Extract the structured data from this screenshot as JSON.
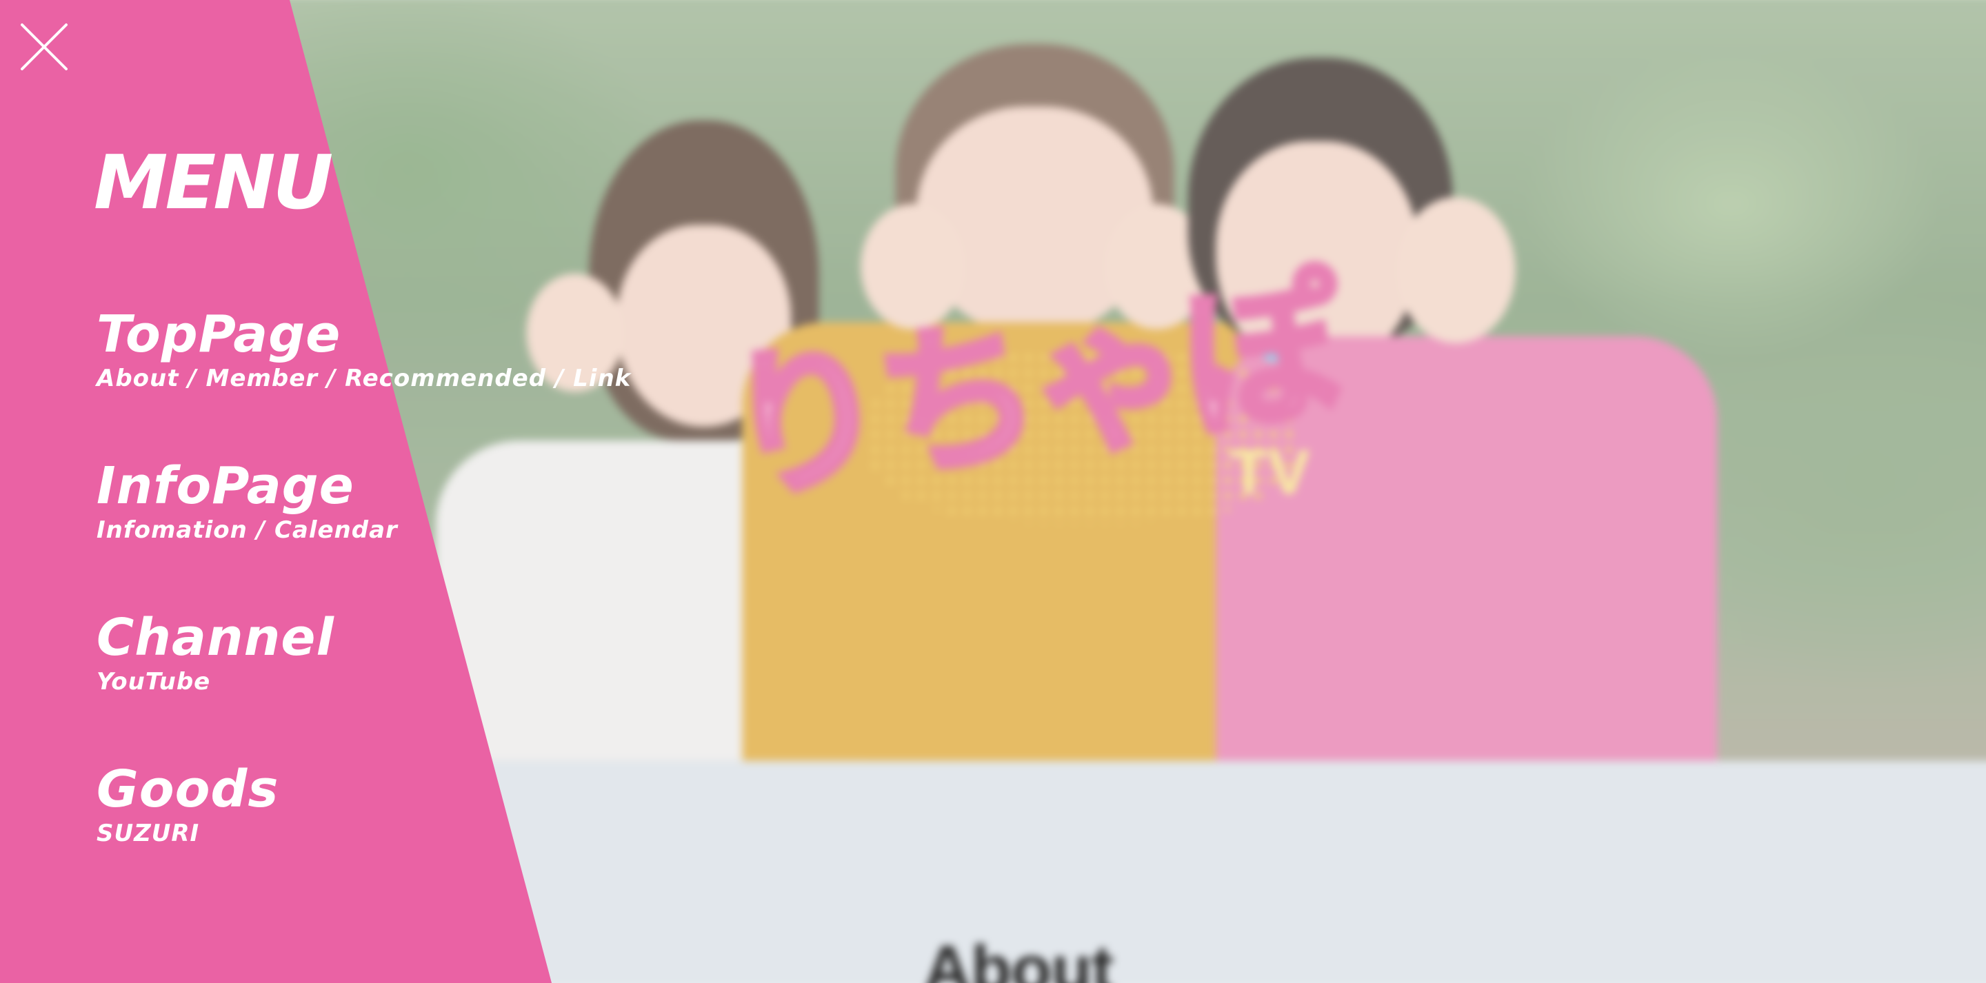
{
  "menu": {
    "heading": "MENU",
    "close_icon": "close-icon",
    "items": [
      {
        "title": "TopPage",
        "sub": "About / Member / Recommended / Link"
      },
      {
        "title": "InfoPage",
        "sub": "Infomation / Calendar"
      },
      {
        "title": "Channel",
        "sub": "YouTube"
      },
      {
        "title": "Goods",
        "sub": "SUZURI"
      }
    ]
  },
  "hero": {
    "logo_text": "りちゃぽ",
    "logo_sub": "TV"
  },
  "about": {
    "title": "About"
  },
  "colors": {
    "menu_panel": "#ea62a4",
    "menu_text": "#ffffff",
    "about_band": "#e2e7ec",
    "logo_pink": "#e25d9f",
    "logo_yellow": "#f6e78a",
    "logo_blue": "#7cc6e8"
  }
}
